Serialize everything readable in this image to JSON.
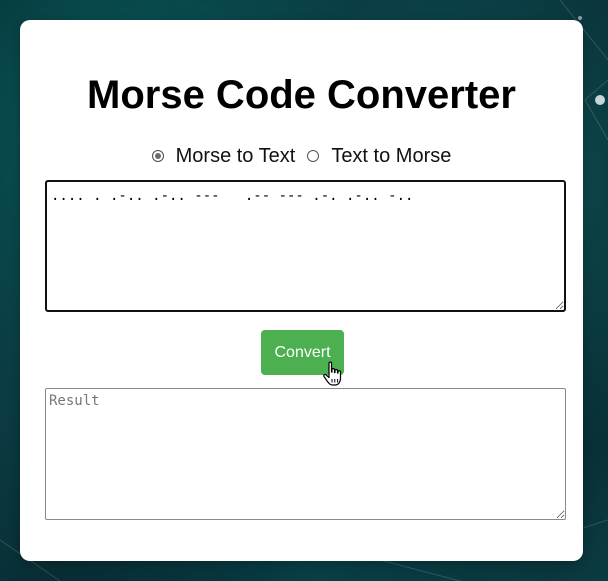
{
  "page": {
    "title": "Morse Code Converter"
  },
  "mode": {
    "options": [
      {
        "label": "Morse to Text",
        "selected": true
      },
      {
        "label": "Text to Morse",
        "selected": false
      }
    ]
  },
  "input": {
    "value": ".... . .-.. .-.. ---   .-- --- .-. .-.. -.."
  },
  "convert": {
    "label": "Convert",
    "color": "#4caf50"
  },
  "result": {
    "value": "",
    "placeholder": "Result"
  },
  "icons": {
    "cursor": "hand-pointer-icon",
    "radio_selected": "radio-selected-icon",
    "radio_unselected": "radio-unselected-icon"
  }
}
